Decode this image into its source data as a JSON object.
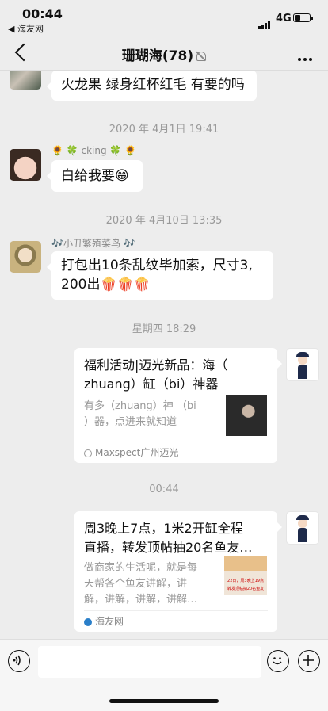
{
  "status_bar": {
    "time": "00:44",
    "back_app": "◀ 海友网",
    "network": "4G"
  },
  "nav": {
    "title": "珊瑚海(78)"
  },
  "messages": {
    "m1": {
      "text": "火龙果 绿身红杯红毛 有要的吗"
    },
    "t1": "2020 年 4月1日 19:41",
    "m2": {
      "sender": "🌻 🍀 cking 🍀 🌻",
      "text": "白给我要😁"
    },
    "t2": "2020 年 4月10日 13:35",
    "m3": {
      "sender": "🎶小丑繁殖菜鸟 🎶",
      "line1": "打包出10条乱纹毕加索，尺寸3,",
      "line2": "200出🍿🍿🍿"
    },
    "t3": "星期四 18:29",
    "card1": {
      "title_line1": "福利活动|迈光新品：海（",
      "title_line2": "zhuang）缸（bi）神器",
      "desc_line1": "有多（zhuang）神 （bi",
      "desc_line2": "）器，点进来就知道",
      "source": "Maxspect广州迈光"
    },
    "t4": "00:44",
    "card2": {
      "title_line1": "周3晚上7点，1米2开缸全程",
      "title_line2": "直播，转发顶帖抽20名鱼友…",
      "desc_line1": "做商家的生活呢，就是每",
      "desc_line2": "天帮各个鱼友讲解，讲",
      "desc_line3": "解，讲解，讲解，讲解…",
      "source": "海友网",
      "thumb_text1": "22日，周3晚上19点",
      "thumb_text2": "转发顶帖抽20名鱼友"
    }
  },
  "colors": {
    "bubble": "#ffffff",
    "background": "#ededed",
    "timestamp": "#999999"
  }
}
